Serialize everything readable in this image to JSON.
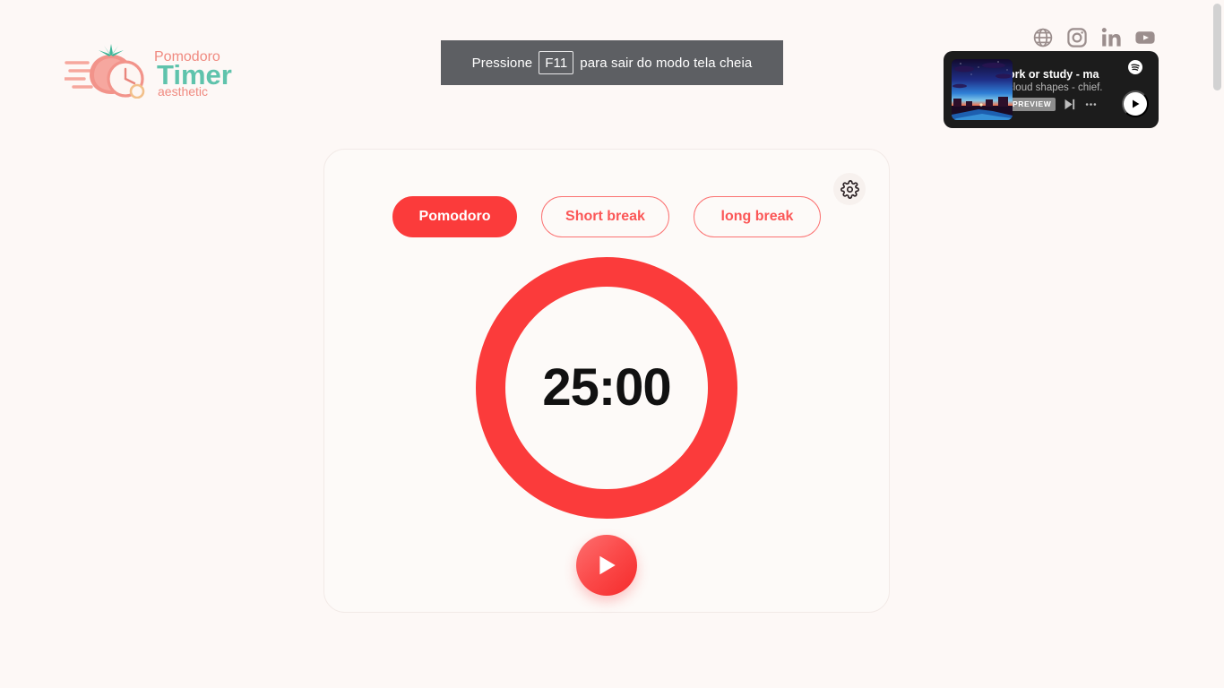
{
  "app": {
    "logo": {
      "line1": "Pomodoro",
      "line2": "Timer",
      "line3": "aesthetic",
      "color_line1": "#f08a80",
      "color_line2": "#5fc3ac",
      "color_line3": "#f08a80"
    }
  },
  "fullscreen_banner": {
    "text_before": "Pressione",
    "key": "F11",
    "text_after": "para sair do modo tela cheia",
    "bg": "#5d5f63",
    "fg": "#ffffff"
  },
  "socials": {
    "items": [
      {
        "icon": "globe-icon",
        "label": "Website"
      },
      {
        "icon": "instagram-icon",
        "label": "Instagram"
      },
      {
        "icon": "linkedin-icon",
        "label": "LinkedIn"
      },
      {
        "icon": "youtube-icon",
        "label": "YouTube"
      }
    ],
    "color": "#9b8e8d"
  },
  "spotify": {
    "track_title": "ork or study - ma",
    "track_subtitle": "cloud shapes  -  chief.",
    "preview_badge": "PREVIEW",
    "bg": "#1c1c1c",
    "controls": {
      "next": "next-track-icon",
      "more": "more-options-icon",
      "play": "play-icon",
      "brand": "spotify-logo-icon"
    }
  },
  "timer_card": {
    "tabs": [
      {
        "label": "Pomodoro",
        "active": true
      },
      {
        "label": "Short break",
        "active": false
      },
      {
        "label": "long break",
        "active": false
      }
    ],
    "time_display": "25:00",
    "accent": "#fb3b3b",
    "settings_label": "Settings",
    "play_label": "Start"
  },
  "scrollbar": {
    "thumb_color": "#d2d2d2"
  }
}
